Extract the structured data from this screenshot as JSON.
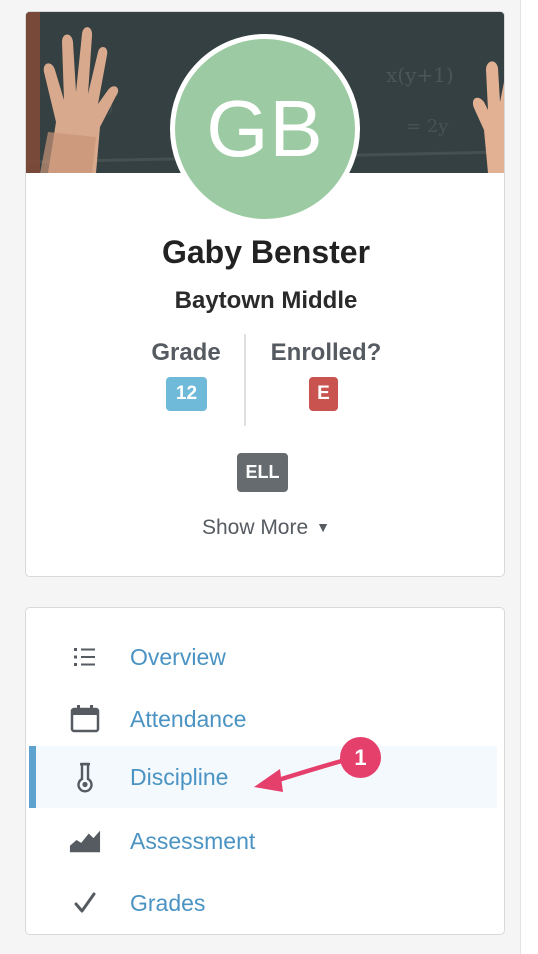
{
  "profile": {
    "initials": "GB",
    "avatar_color": "#9ccba3",
    "name": "Gaby Benster",
    "school": "Baytown Middle",
    "grade_label": "Grade",
    "grade_value": "12",
    "enrolled_label": "Enrolled?",
    "enrolled_value": "E",
    "tag": "ELL",
    "show_more": "Show More",
    "show_more_icon": "caret-down-icon"
  },
  "nav": {
    "accent_color": "#5ea3cf",
    "items": [
      {
        "label": "Overview",
        "icon": "list-icon",
        "active": false
      },
      {
        "label": "Attendance",
        "icon": "calendar-icon",
        "active": false
      },
      {
        "label": "Discipline",
        "icon": "thermometer-icon",
        "active": true
      },
      {
        "label": "Assessment",
        "icon": "area-chart-icon",
        "active": false
      },
      {
        "label": "Grades",
        "icon": "checkmark-icon",
        "active": false
      }
    ]
  },
  "annotation": {
    "number": "1",
    "color": "#e53f6b"
  }
}
